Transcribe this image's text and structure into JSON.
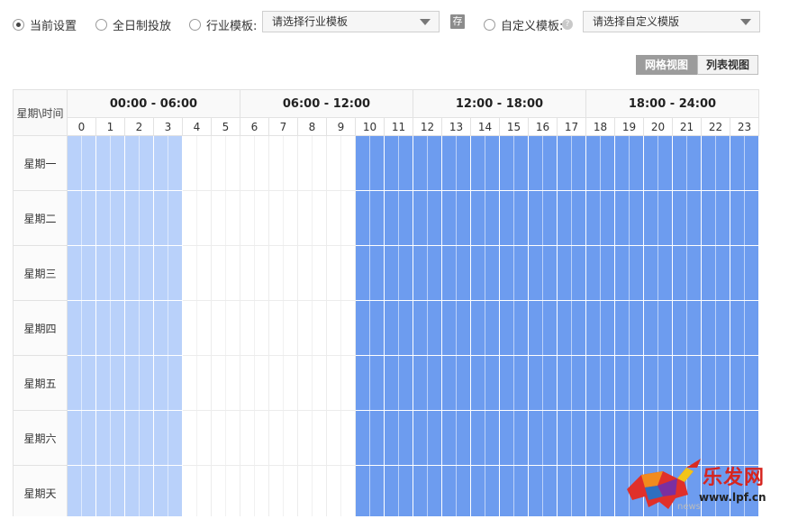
{
  "toolbar": {
    "current_setting": "当前设置",
    "all_day": "全日制投放",
    "industry_template": "行业模板:",
    "industry_select_placeholder": "请选择行业模板",
    "save_icon_text": "存",
    "custom_template": "自定义模板:",
    "help_icon_text": "?",
    "custom_select_placeholder": "请选择自定义模版",
    "selected_option": "current_setting"
  },
  "view_toggle": {
    "grid_view": "网格视图",
    "list_view": "列表视图",
    "active": "grid_view"
  },
  "schedule": {
    "corner_label": "星期\\时间",
    "time_ranges": [
      "00:00 - 06:00",
      "06:00 - 12:00",
      "12:00 - 18:00",
      "18:00 - 24:00"
    ],
    "hours": [
      "0",
      "1",
      "2",
      "3",
      "4",
      "5",
      "6",
      "7",
      "8",
      "9",
      "10",
      "11",
      "12",
      "13",
      "14",
      "15",
      "16",
      "17",
      "18",
      "19",
      "20",
      "21",
      "22",
      "23"
    ],
    "days": [
      "星期一",
      "星期二",
      "星期三",
      "星期四",
      "星期五",
      "星期六",
      "星期天"
    ],
    "level_colors": [
      "#ffffff",
      "#b9d1fa",
      "#98bbf6",
      "#6d9cef"
    ],
    "hour_levels": [
      1,
      1,
      1,
      1,
      0,
      0,
      0,
      0,
      0,
      0,
      3,
      3,
      3,
      3,
      3,
      3,
      3,
      3,
      3,
      3,
      3,
      3,
      3,
      3
    ],
    "levels_note_per_column": "levels per hour column; same for every day"
  },
  "watermark": {
    "brand": "乐发网",
    "url": "www.lpf.cn",
    "sub": "news"
  }
}
